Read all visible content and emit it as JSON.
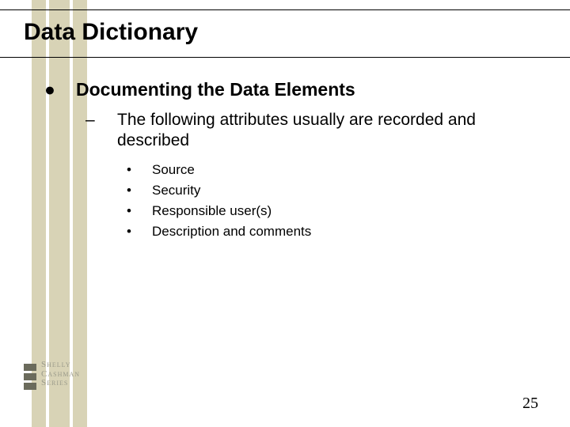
{
  "title": "Data Dictionary",
  "lvl1": {
    "bullet": "●",
    "text": "Documenting the Data Elements"
  },
  "lvl2": {
    "bullet": "–",
    "text": "The following attributes usually are recorded and described"
  },
  "lvl3": [
    {
      "bullet": "•",
      "text": "Source"
    },
    {
      "bullet": "•",
      "text": "Security"
    },
    {
      "bullet": "•",
      "text": "Responsible user(s)"
    },
    {
      "bullet": "•",
      "text": "Description and comments"
    }
  ],
  "logo": {
    "line1": "Shelly",
    "line2": "Cashman",
    "line3": "Series"
  },
  "page_number": "25"
}
